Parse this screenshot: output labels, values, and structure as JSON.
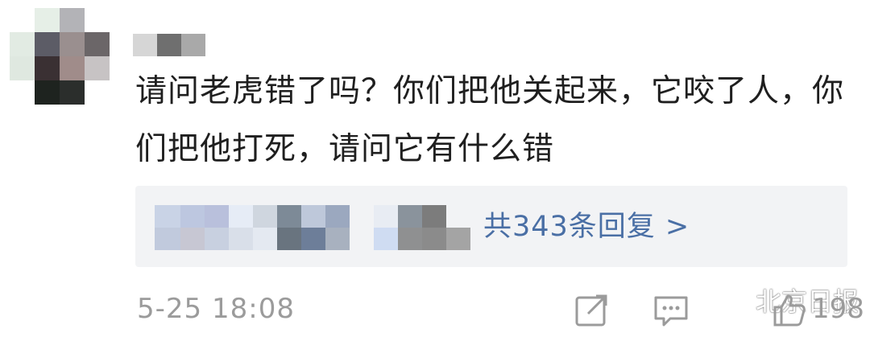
{
  "comment": {
    "text": "请问老虎错了吗？你们把他关起来，它咬了人，你们把他打死，请问它有什么错"
  },
  "replies": {
    "link_label": "共343条回复 >"
  },
  "footer": {
    "timestamp": "5-25 18:08",
    "like_count": "198"
  },
  "watermark": {
    "text": "北京日报"
  },
  "icons": {
    "share": "share-icon",
    "comment": "comment-icon",
    "like": "like-icon",
    "watermark_logo": "wechat-icon"
  },
  "colors": {
    "link": "#4a6fa5",
    "text": "#1f1f1f",
    "meta": "#9b9b9b",
    "reply_bg": "#f2f3f5"
  }
}
